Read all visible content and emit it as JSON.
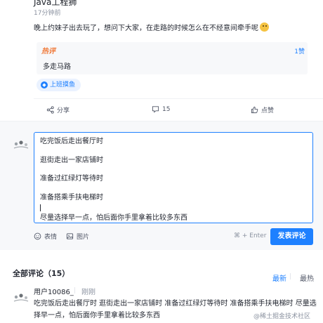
{
  "post": {
    "author": "Java工程狮",
    "time": "17分钟前",
    "content": "晚上约妹子出去玩了，想问下大家，在走路的时候怎么在不经意间牵手呢",
    "emoji": "thinking-face"
  },
  "hot_comment": {
    "tag": "热评",
    "likes": "1赞",
    "text": "多走马路"
  },
  "topic": {
    "label": "上班摸鱼"
  },
  "actions": {
    "share": "分享",
    "comments": "15",
    "like": "点赞"
  },
  "editor": {
    "lines": [
      "吃完饭后走出餐厅时",
      "逛街走出一家店铺时",
      "准备过红绿灯等待时",
      "准备搭乘手扶电梯时",
      "尽量选择早一点，怕后面你手里拿着比较多东西"
    ],
    "emoji_label": "表情",
    "image_label": "图片",
    "shortcut": "⌘ + Enter",
    "submit": "发表评论"
  },
  "comments_section": {
    "title": "全部评论（15）",
    "sort_newest": "最新",
    "sort_hottest": "最热"
  },
  "first_comment": {
    "user": "用户10086_",
    "time": "刚刚",
    "text": "吃完饭后走出餐厅时 逛街走出一家店铺时 准备过红绿灯等待时 准备搭乘手扶电梯时 尽量选择早一点，怕后面你手里拿着比较多东西"
  },
  "watermark": "@稀土掘金技术社区",
  "colors": {
    "accent": "#1e80ff",
    "hot_tag": "#f07a3a",
    "editor_bg": "#f7f8fa"
  }
}
